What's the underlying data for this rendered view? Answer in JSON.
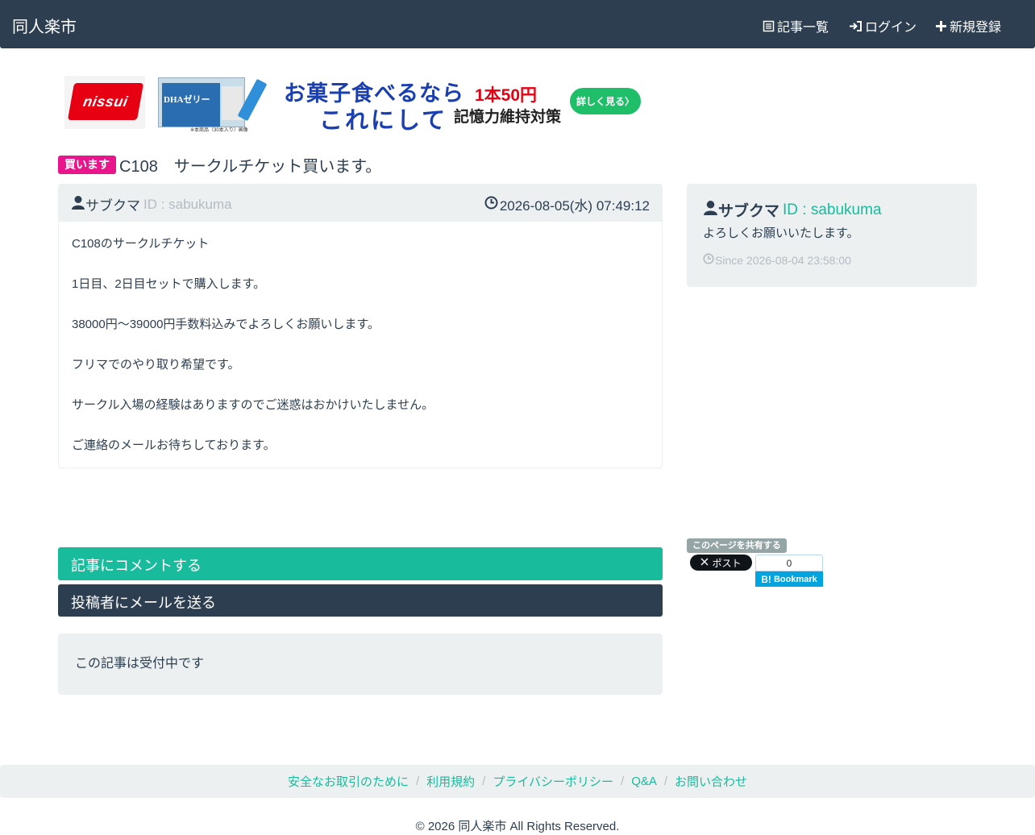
{
  "navbar": {
    "brand": "同人楽市",
    "articles_label": "記事一覧",
    "login_label": "ログイン",
    "register_label": "新規登録"
  },
  "ad": {
    "logo_text": "nissui",
    "product_text": "DHAゼリー",
    "product_note": "※本商品（30本入り）画像",
    "headline_1": "お菓子食べるなら",
    "headline_2": "これにして",
    "price": "1本50円",
    "subline": "記憶力維持対策",
    "cta": "詳しく見る〉"
  },
  "post": {
    "badge": "買います",
    "title": "C108　サークルチケット買います。",
    "user_name": "サブクマ",
    "user_id": "ID : sabukuma",
    "date": "2026-08-05(水) 07:49:12",
    "body": [
      "C108のサークルチケット",
      "1日目、2日目セットで購入します。",
      "38000円～39000円手数料込みでよろしくお願いします。",
      "フリマでのやり取り希望です。",
      "サークル入場の経験はありますのでご迷惑はおかけいたしません。",
      "ご連絡のメールお待ちしております。"
    ]
  },
  "profile": {
    "name": "サブクマ",
    "id": "ID : sabukuma",
    "message": "よろしくお願いいたします。",
    "since": "Since 2026-08-04 23:58:00"
  },
  "share": {
    "label": "このページを共有する",
    "x_post": "ポスト",
    "hatena_count": "0",
    "hatena_label": "Bookmark"
  },
  "actions": {
    "comment": "記事にコメントする",
    "mail": "投稿者にメールを送る",
    "status": "この記事は受付中です"
  },
  "footer": {
    "links": [
      "安全なお取引のために",
      "利用規約",
      "プライバシーポリシー",
      "Q&A",
      "お問い合わせ"
    ],
    "copyright": "© 2026 同人楽市 All Rights Reserved."
  },
  "colors": {
    "navbar": "#2c3e50",
    "accent": "#18bc9c",
    "badge": "#e8168a",
    "well": "#ecf0f1"
  }
}
